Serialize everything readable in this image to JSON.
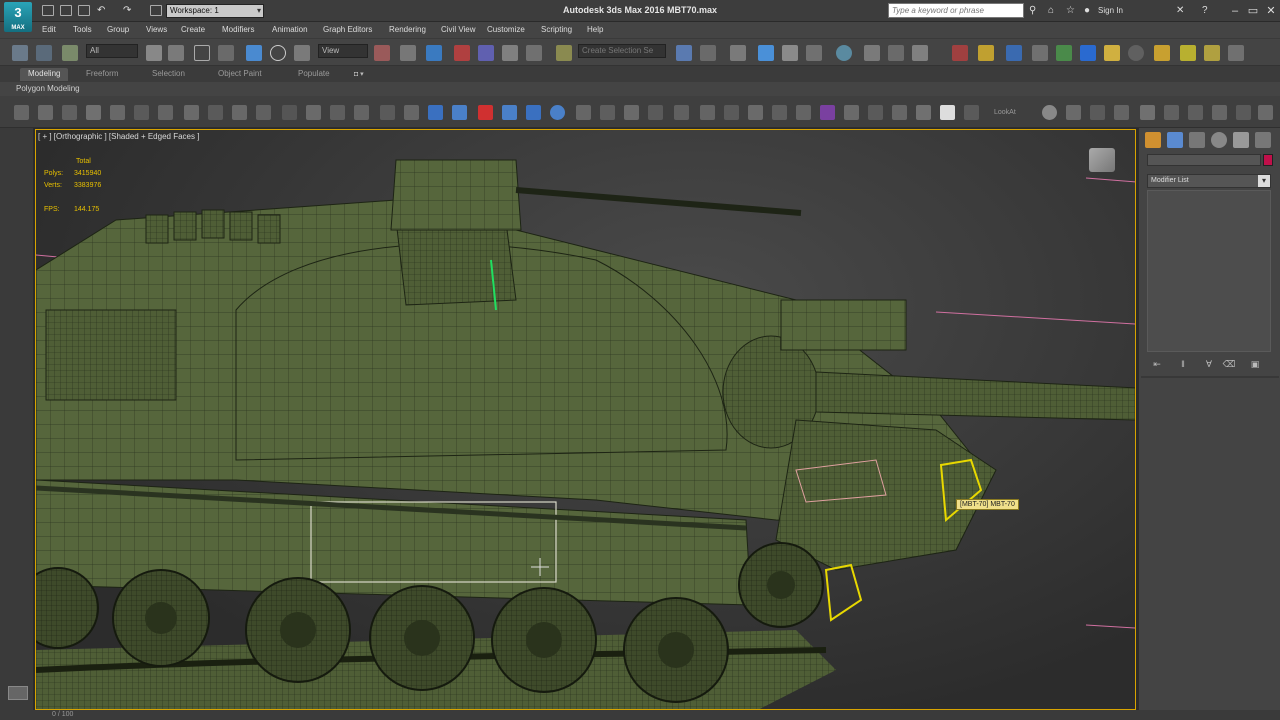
{
  "app": {
    "logo_text": "3",
    "logo_sub": "MAX",
    "window_title": "Autodesk 3ds Max 2016     MBT70.max",
    "workspace": "Workspace: 1",
    "search_placeholder": "Type a keyword or phrase",
    "signin": "Sign In"
  },
  "menu": [
    "Edit",
    "Tools",
    "Group",
    "Views",
    "Create",
    "Modifiers",
    "Animation",
    "Graph Editors",
    "Rendering",
    "Civil View",
    "Customize",
    "Scripting",
    "Help"
  ],
  "toolbar": {
    "selection_filter": "All",
    "reference_coord": "View",
    "named_selection_placeholder": "Create Selection Se"
  },
  "ribbon": {
    "tabs": [
      "Modeling",
      "Freeform",
      "Selection",
      "Object Paint",
      "Populate"
    ],
    "active_tab": "Modeling",
    "panel_label": "Polygon Modeling",
    "lookat_label": "LookAt"
  },
  "viewport": {
    "label": "[ + ] [Orthographic ] [Shaded + Edged Faces ]",
    "stats": {
      "header": "Total",
      "polys_label": "Polys:",
      "polys_value": "3415940",
      "verts_label": "Verts:",
      "verts_value": "3383976",
      "fps_label": "FPS:",
      "fps_value": "144.175"
    },
    "tooltip": "[MBT-70] MBT-70"
  },
  "command_panel": {
    "modifier_list": "Modifier List"
  },
  "status": {
    "time_slider": "0 / 100"
  },
  "colors": {
    "viewport_border": "#d8a400",
    "tank_green": "#56663c",
    "selection_yellow": "#e8d800",
    "stats_yellow": "#e8c000"
  }
}
